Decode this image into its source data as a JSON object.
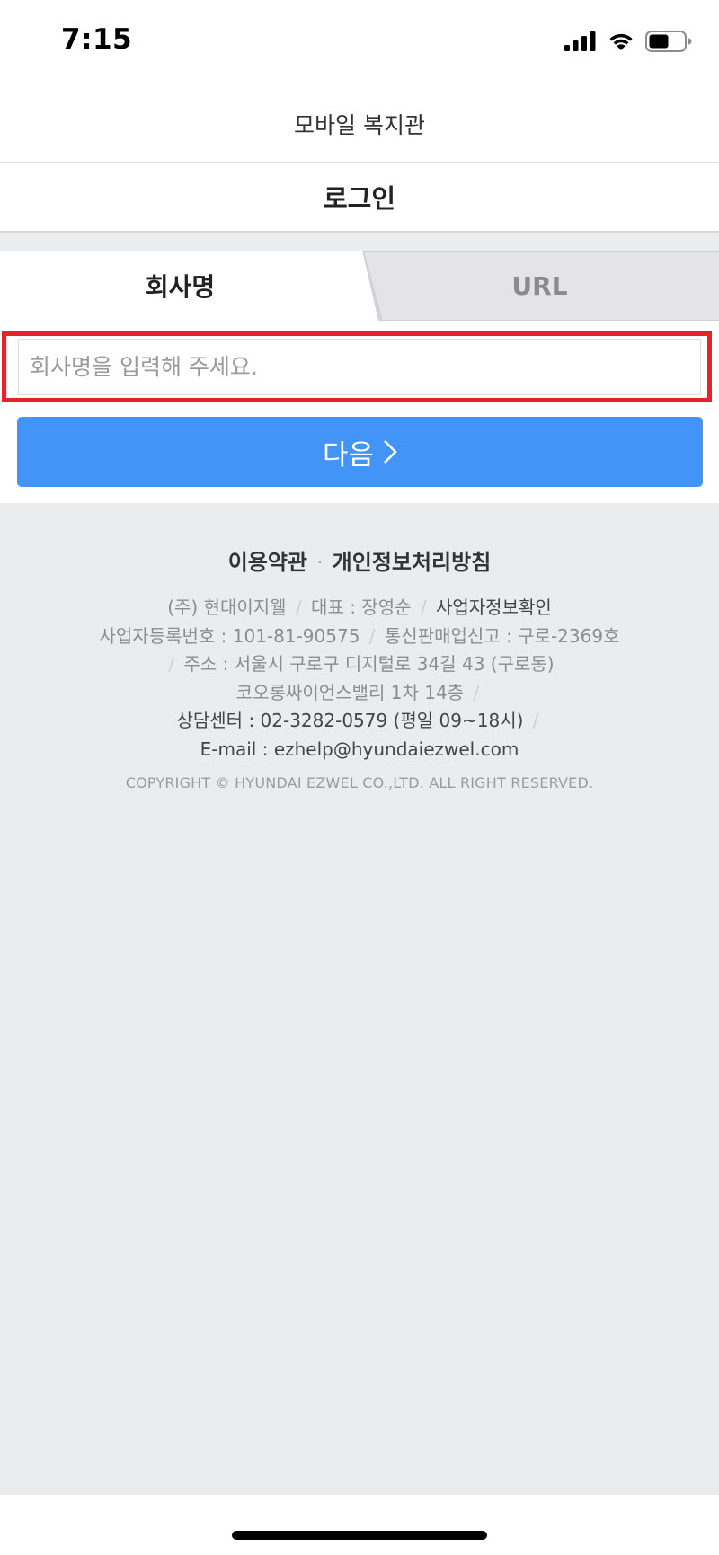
{
  "status_bar": {
    "time": "7:15"
  },
  "header": {
    "title": "모바일 복지관"
  },
  "page": {
    "title": "로그인"
  },
  "tabs": [
    {
      "label": "회사명",
      "active": true
    },
    {
      "label": "URL",
      "active": false
    }
  ],
  "form": {
    "company_placeholder": "회사명을 입력해 주세요.",
    "company_value": "",
    "next_label": "다음",
    "highlight_color": "#e8212b",
    "button_color": "#4294f7"
  },
  "footer": {
    "links": [
      "이용약관",
      "개인정보처리방침"
    ],
    "link_separator": "·",
    "company": "(주) 현대이지웰",
    "ceo": "대표 : 장영순",
    "business_info_link": "사업자정보확인",
    "biz_reg_number": "사업자등록번호 : 101-81-90575",
    "mail_order_report": "통신판매업신고 : 구로-2369호",
    "address_line1": "주소 : 서울시 구로구 디지털로 34길 43 (구로동)",
    "address_line2": "코오롱싸이언스밸리 1차 14층",
    "service_center": "상담센터 : 02-3282-0579 (평일 09~18시)",
    "email": "E-mail : ezhelp@hyundaiezwel.com",
    "separator": "/",
    "copyright": "COPYRIGHT © HYUNDAI EZWEL CO.,LTD. ALL RIGHT RESERVED."
  }
}
